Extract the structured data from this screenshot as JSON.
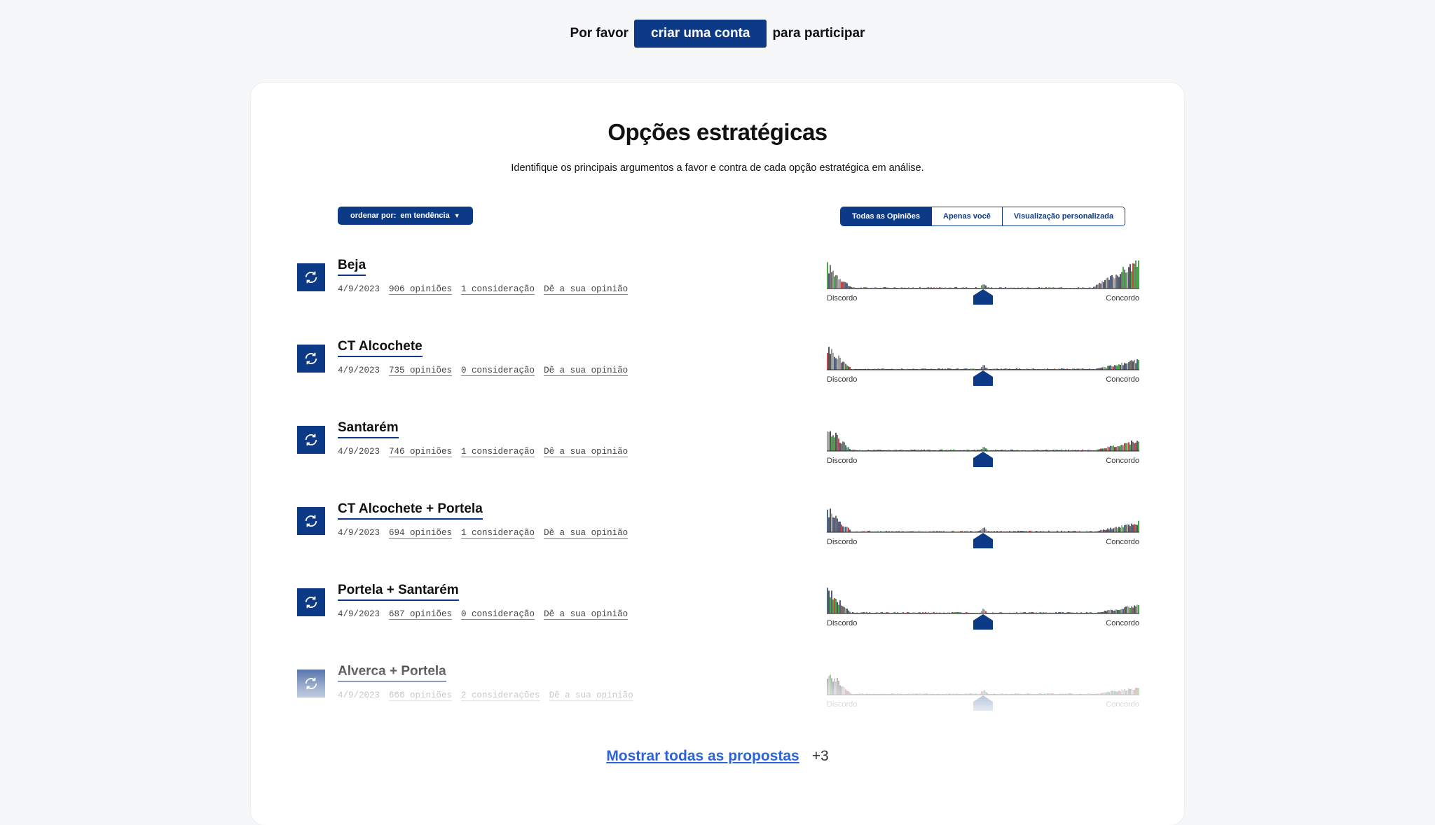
{
  "topbar": {
    "prefix": "Por favor",
    "cta_label": "criar uma conta",
    "suffix": "para participar"
  },
  "section": {
    "title": "Opções estratégicas",
    "subtitle": "Identifique os principais argumentos a favor e contra de cada opção estratégica em análise."
  },
  "sort": {
    "prefix": "ordenar por:",
    "value": "em tendência"
  },
  "view_toggle": {
    "options": [
      "Todas as Opiniões",
      "Apenas você",
      "Visualização personalizada"
    ],
    "active": "Todas as Opiniões"
  },
  "colors": {
    "brand": "#0d3a87",
    "link": "#2d63d8"
  },
  "histogram_labels": {
    "left": "Discordo",
    "right": "Concordo"
  },
  "proposals": [
    {
      "title": "Beja",
      "date": "4/9/2023",
      "opinions": "906 opiniões",
      "considerations": "1 consideração",
      "action": "Dê a sua opinião"
    },
    {
      "title": "CT Alcochete",
      "date": "4/9/2023",
      "opinions": "735 opiniões",
      "considerations": "0 consideração",
      "action": "Dê a sua opinião"
    },
    {
      "title": "Santarém",
      "date": "4/9/2023",
      "opinions": "746 opiniões",
      "considerations": "1 consideração",
      "action": "Dê a sua opinião"
    },
    {
      "title": "CT Alcochete + Portela",
      "date": "4/9/2023",
      "opinions": "694 opiniões",
      "considerations": "1 consideração",
      "action": "Dê a sua opinião"
    },
    {
      "title": "Portela + Santarém",
      "date": "4/9/2023",
      "opinions": "687 opiniões",
      "considerations": "0 consideração",
      "action": "Dê a sua opinião"
    },
    {
      "title": "Alverca + Portela",
      "date": "4/9/2023",
      "opinions": "666 opiniões",
      "considerations": "2 considerações",
      "action": "Dê a sua opinião"
    }
  ],
  "show_all": {
    "label": "Mostrar todas as propostas",
    "count": "+3"
  }
}
